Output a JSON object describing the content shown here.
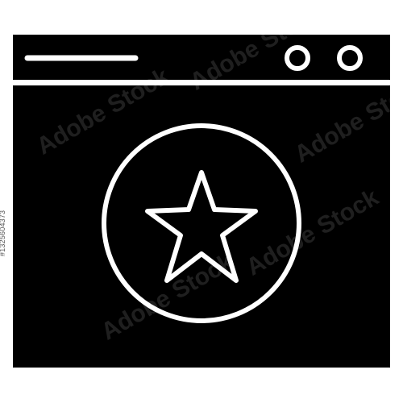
{
  "icon": {
    "name": "browser-window-star-icon",
    "fill_color": "#000000",
    "line_color": "#ffffff",
    "background_color": "#ffffff"
  },
  "watermark": {
    "text": "Adobe Stock",
    "image_id": "#1325604373"
  }
}
